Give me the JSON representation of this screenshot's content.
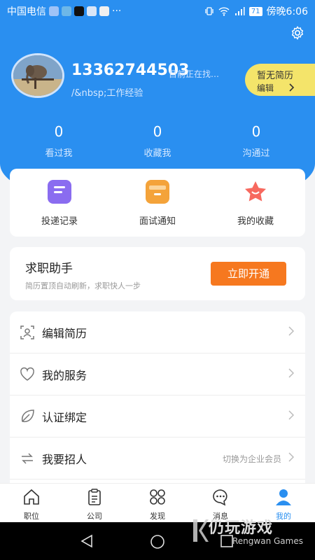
{
  "status_bar": {
    "carrier": "中国电信",
    "dots": "···",
    "battery": "71",
    "time": "傍晚6:06"
  },
  "profile": {
    "phone": "13362744503",
    "job_status": "目前正在找…",
    "experience": "/&nbsp;工作经验",
    "resume_line1": "暂无简历",
    "resume_line2": "编辑"
  },
  "stats": [
    {
      "value": "0",
      "label": "看过我"
    },
    {
      "value": "0",
      "label": "收藏我"
    },
    {
      "value": "0",
      "label": "沟通过"
    }
  ],
  "quick_actions": [
    {
      "label": "投递记录",
      "icon": "document-icon"
    },
    {
      "label": "面试通知",
      "icon": "envelope-icon"
    },
    {
      "label": "我的收藏",
      "icon": "star-icon"
    }
  ],
  "job_assistant": {
    "title": "求职助手",
    "subtitle": "简历置顶自动刷新，求职快人一步",
    "button": "立即开通"
  },
  "menu": [
    {
      "label": "编辑简历",
      "icon": "resume-icon",
      "right_text": ""
    },
    {
      "label": "我的服务",
      "icon": "heart-icon",
      "right_text": ""
    },
    {
      "label": "认证绑定",
      "icon": "leaf-icon",
      "right_text": ""
    },
    {
      "label": "我要招人",
      "icon": "switch-icon",
      "right_text": "切换为企业会员"
    }
  ],
  "tabs": [
    {
      "label": "职位",
      "icon": "home-icon"
    },
    {
      "label": "公司",
      "icon": "clipboard-icon"
    },
    {
      "label": "发现",
      "icon": "grid-icon"
    },
    {
      "label": "消息",
      "icon": "chat-icon"
    },
    {
      "label": "我的",
      "icon": "person-icon"
    }
  ],
  "watermark": {
    "title": "仍玩游戏",
    "subtitle": "Rengwan Games"
  },
  "colors": {
    "primary": "#2a8ff0",
    "accent_orange": "#f6781f",
    "resume_yellow": "#f4e46a"
  }
}
